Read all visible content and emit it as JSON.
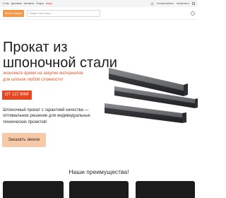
{
  "topbar": {
    "nav": [
      "О нас",
      "Доставка",
      "Контакты",
      "Услуги",
      "Акции"
    ],
    "cabinet": "Личный кабинет",
    "contact": "info@mail.ru"
  },
  "header": {
    "catalog_label": "Каталог товаров",
    "search_placeholder": "Введите ваш запрос"
  },
  "hero": {
    "title_line1": "Прокат из",
    "title_line2": "шпоночной стали",
    "subtitle_line1": "экономьте время на закупке материалов",
    "subtitle_line2": "для шпонок любой сложности!",
    "price": "ОТ 127 ₽/М²",
    "desc_line1": "Шпоночный прокат с гарантией качества —",
    "desc_line2": "оптимальное решение для индивидуальных",
    "desc_line3": "технических проектов!",
    "cta": "Заказать звонок"
  },
  "advantages": {
    "title": "Наши преимущества!"
  },
  "colors": {
    "accent": "#e8461f",
    "catalog": "#f29a4a",
    "cta_bg": "#f6c9a8",
    "card_bg": "#1b1b1b"
  }
}
